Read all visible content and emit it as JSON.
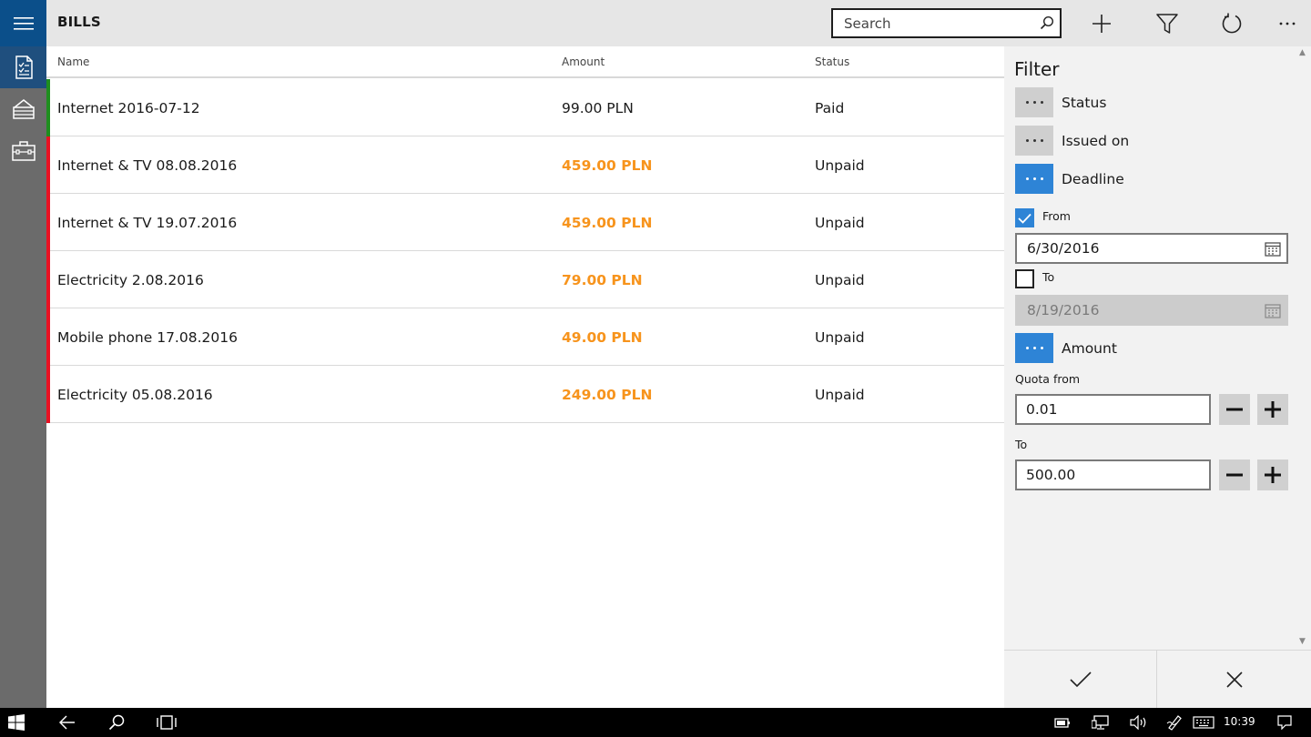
{
  "app": {
    "title": "BILLS",
    "search_placeholder": "Search",
    "toolbar": [
      "add-icon",
      "filter-icon",
      "refresh-icon",
      "more-icon"
    ]
  },
  "nav": {
    "items": [
      "bills-icon",
      "inbox-icon",
      "briefcase-icon"
    ],
    "active": 0
  },
  "table": {
    "columns": [
      "Name",
      "Amount",
      "Status"
    ],
    "rows": [
      {
        "name": "Internet 2016-07-12",
        "amount": "99.00 PLN",
        "status": "Paid",
        "paid": true
      },
      {
        "name": "Internet & TV 08.08.2016",
        "amount": "459.00 PLN",
        "status": "Unpaid",
        "paid": false
      },
      {
        "name": "Internet & TV 19.07.2016",
        "amount": "459.00 PLN",
        "status": "Unpaid",
        "paid": false
      },
      {
        "name": "Electricity 2.08.2016",
        "amount": "79.00 PLN",
        "status": "Unpaid",
        "paid": false
      },
      {
        "name": "Mobile phone 17.08.2016",
        "amount": "49.00 PLN",
        "status": "Unpaid",
        "paid": false
      },
      {
        "name": "Electricity 05.08.2016",
        "amount": "249.00 PLN",
        "status": "Unpaid",
        "paid": false
      }
    ]
  },
  "colors": {
    "paid_bar": "#1e8e1e",
    "unpaid_bar": "#e81123",
    "unpaid_amount": "#f7941d",
    "accent": "#2e84d6"
  },
  "filter": {
    "title": "Filter",
    "status_label": "Status",
    "status_on": false,
    "issued_label": "Issued on",
    "issued_on": false,
    "deadline_label": "Deadline",
    "deadline_on": true,
    "from_label": "From",
    "from_checked": true,
    "from_value": "6/30/2016",
    "to_label": "To",
    "to_checked": false,
    "to_value": "8/19/2016",
    "amount_label": "Amount",
    "amount_on": true,
    "quota_from_label": "Quota from",
    "quota_from_value": "0.01",
    "quota_to_label": "To",
    "quota_to_value": "500.00"
  },
  "taskbar": {
    "time": "10:39"
  }
}
